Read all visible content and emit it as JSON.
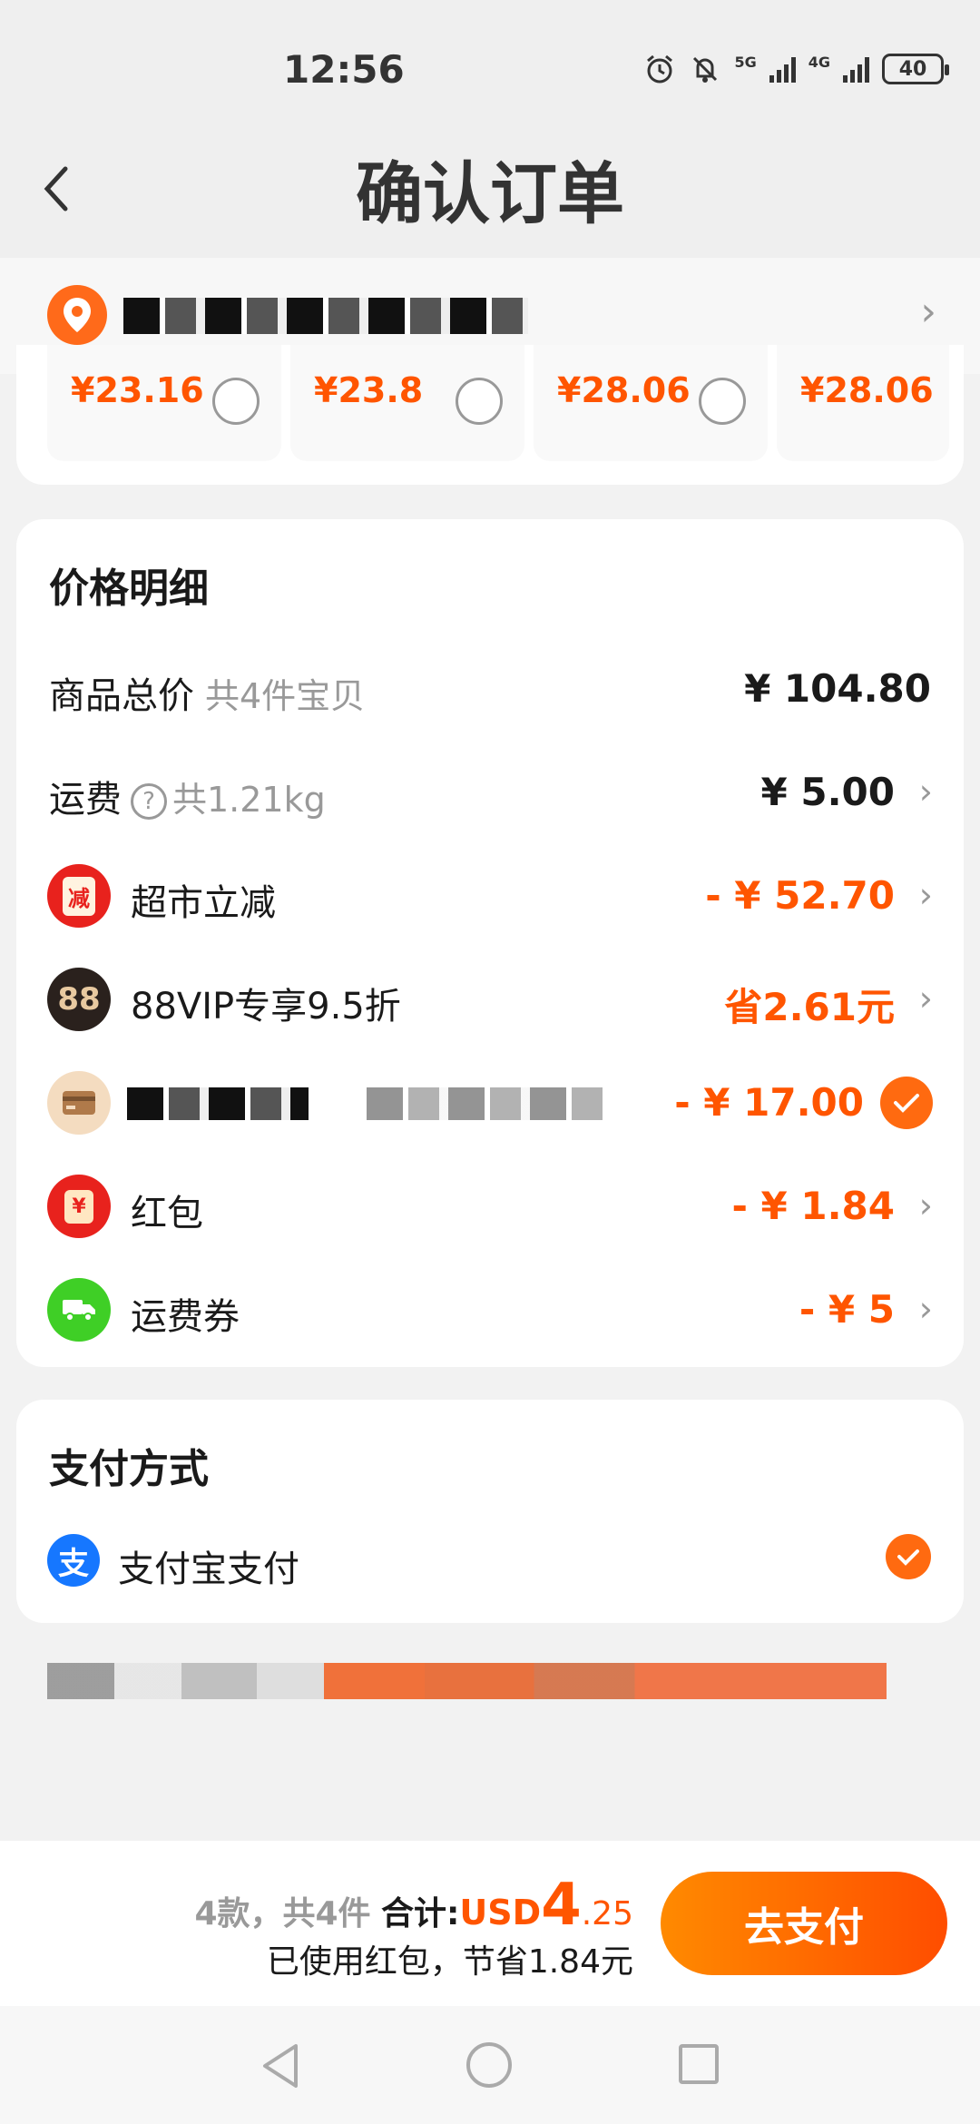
{
  "status_bar": {
    "time": "12:56",
    "network_1": "5G",
    "network_2": "4G",
    "battery": "40",
    "icons": [
      "alarm-icon",
      "mute-icon",
      "signal-icon",
      "signal-icon",
      "battery-icon"
    ]
  },
  "header": {
    "title": "确认订单",
    "back_icon": "chevron-left-icon"
  },
  "address": {
    "icon": "location-pin-icon",
    "chevron": "›"
  },
  "price_options": [
    {
      "price": "¥23.16",
      "selected": false
    },
    {
      "price": "¥23.8",
      "selected": false
    },
    {
      "price": "¥28.06",
      "selected": false
    },
    {
      "price": "¥28.06",
      "selected": false
    }
  ],
  "price_detail": {
    "title": "价格明细",
    "total_goods": {
      "label": "商品总价",
      "sub": "共4件宝贝",
      "value": "¥ 104.80"
    },
    "shipping": {
      "label": "运费",
      "sub": "共1.21kg",
      "value": "¥ 5.00"
    },
    "supermarket_discount": {
      "label": "超市立减",
      "value": "- ¥ 52.70",
      "icon_text": "减"
    },
    "vip_discount": {
      "label": "88VIP专享9.5折",
      "value": "省2.61元",
      "icon_text": "88"
    },
    "card_discount": {
      "value": "- ¥ 17.00",
      "checked": true
    },
    "red_packet": {
      "label": "红包",
      "value": "- ¥ 1.84",
      "icon_text": "¥"
    },
    "shipping_coupon": {
      "label": "运费券",
      "value": "- ¥ 5"
    },
    "chevron": "›",
    "question_mark": "?"
  },
  "payment": {
    "title": "支付方式",
    "method": "支付宝支付",
    "icon_text": "支",
    "selected": true
  },
  "bottom": {
    "count_text": "4款，共4件",
    "total_label": "合计:",
    "currency": "USD",
    "amount_int": "4",
    "amount_dec": ".25",
    "savings_text": "已使用红包，节省1.84元",
    "pay_button": "去支付"
  },
  "colors": {
    "accent": "#ff5500",
    "button_gradient_start": "#ff8a00",
    "button_gradient_end": "#ff4d00",
    "alipay": "#1677ff"
  }
}
